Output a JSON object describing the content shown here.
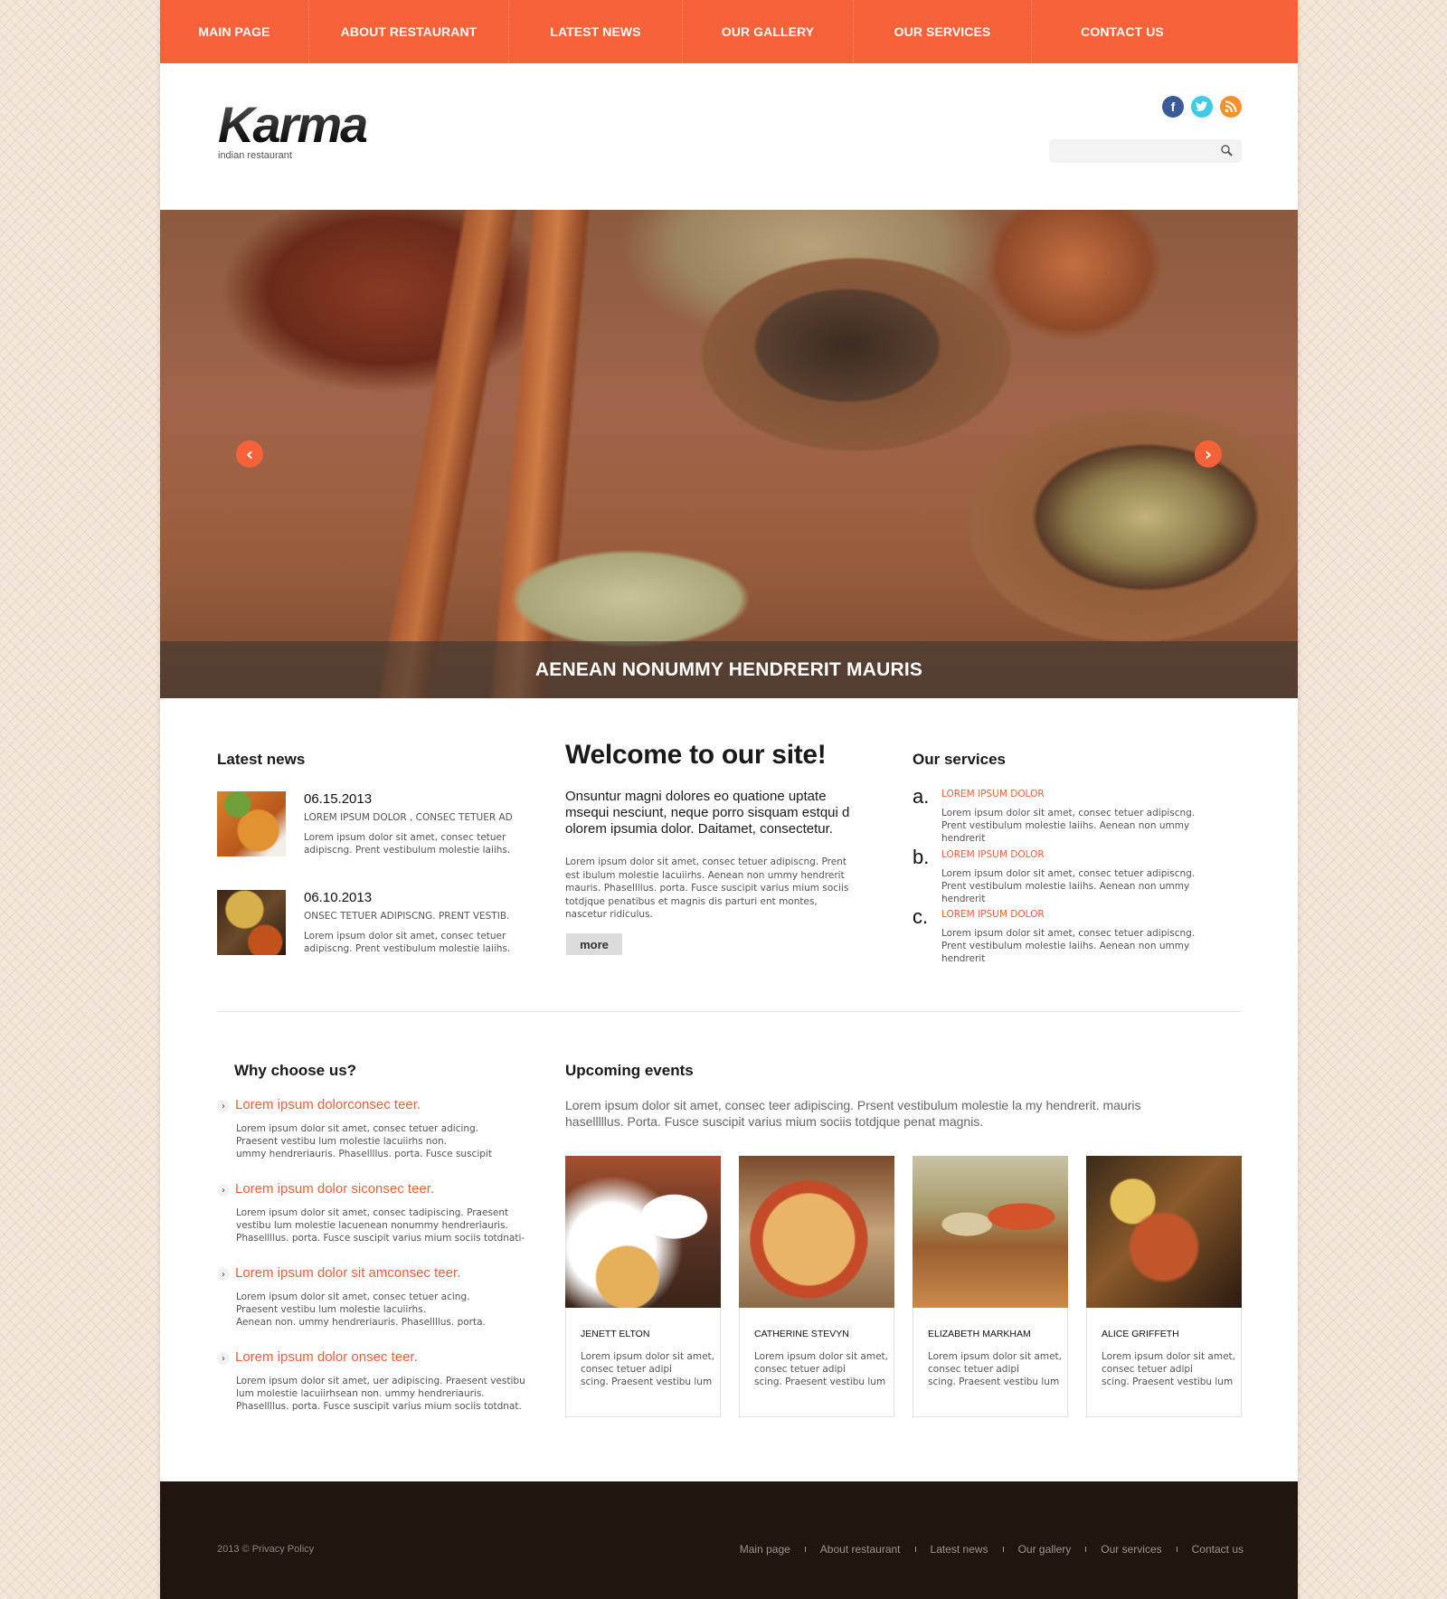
{
  "nav": {
    "items": [
      {
        "label": "MAIN PAGE"
      },
      {
        "label": "ABOUT RESTAURANT"
      },
      {
        "label": "LATEST NEWS"
      },
      {
        "label": "OUR GALLERY"
      },
      {
        "label": "OUR SERVICES"
      },
      {
        "label": "CONTACT US"
      }
    ]
  },
  "header": {
    "logo": "Karma",
    "tagline": "indian restaurant",
    "social": {
      "facebook": "f",
      "twitter": "t",
      "rss": "rss"
    },
    "search": {
      "value": "",
      "placeholder": ""
    }
  },
  "slider": {
    "caption": "AENEAN NONUMMY HENDRERIT MAURIS",
    "prev": "‹",
    "next": "›"
  },
  "latest_news": {
    "heading": "Latest news",
    "items": [
      {
        "date": "06.15.2013",
        "title": "LOREM IPSUM DOLOR , CONSEC TETUER AD",
        "text": "Lorem ipsum dolor sit amet, consec tetuer adipiscng. Prent vestibulum molestie laiihs."
      },
      {
        "date": "06.10.2013",
        "title": "ONSEC TETUER ADIPISCNG. PRENT VESTIB.",
        "text": "Lorem ipsum dolor sit amet, consec tetuer adipiscng. Prent vestibulum molestie laiihs."
      }
    ]
  },
  "welcome": {
    "title": "Welcome to our site!",
    "lead": "Onsuntur magni dolores eo quatione uptate msequi nesciunt, neque porro sisquam estqui d olorem ipsumia dolor. Daitamet, consectetur.",
    "body": "Lorem ipsum dolor sit amet, consec tetuer adipiscng. Prent est ibulum molestie lacuiirhs. Aenean non ummy hendrerit mauris. Phasellllus. porta. Fusce suscipit varius mium sociis totdjque penatibus et magnis dis parturi ent montes, nascetur ridiculus.",
    "more_label": "more"
  },
  "services": {
    "heading": "Our services",
    "items": [
      {
        "letter": "a.",
        "title": "LOREM IPSUM DOLOR",
        "text": "Lorem ipsum dolor sit amet, consec tetuer adipiscng. Prent vestibulum molestie laiihs. Aenean non ummy hendrerit"
      },
      {
        "letter": "b.",
        "title": "LOREM IPSUM DOLOR",
        "text": "Lorem ipsum dolor sit amet, consec tetuer adipiscng. Prent vestibulum molestie laiihs. Aenean non ummy hendrerit"
      },
      {
        "letter": "c.",
        "title": "LOREM IPSUM DOLOR",
        "text": "Lorem ipsum dolor sit amet, consec tetuer adipiscng. Prent vestibulum molestie laiihs. Aenean non ummy hendrerit"
      }
    ]
  },
  "why_choose": {
    "heading": "Why choose us?",
    "bullet": "›",
    "items": [
      {
        "title": "Lorem ipsum dolorconsec teer.",
        "text": "Lorem ipsum dolor sit amet, consec tetuer adicing.\nPraesent vestibu lum molestie lacuiirhs non.\nummy hendreriauris. Phasellllus. porta. Fusce suscipit"
      },
      {
        "title": "Lorem ipsum dolor siconsec teer.",
        "text": "Lorem ipsum dolor sit amet, consec tadipiscing. Praesent\nvestibu lum molestie lacuenean nonummy hendreriauris.\nPhasellllus. porta. Fusce suscipit varius mium sociis totdnati-"
      },
      {
        "title": "Lorem ipsum dolor sit amconsec teer.",
        "text": "Lorem ipsum dolor sit amet, consec tetuer acing.\nPraesent vestibu lum molestie lacuiirhs.\n Aenean non. ummy hendreriauris. Phasellllus. porta."
      },
      {
        "title": "Lorem ipsum dolor onsec teer.",
        "text": "Lorem ipsum dolor sit amet, uer adipiscing. Praesent vestibu\nlum molestie lacuiirhsean non.  ummy hendreriauris.\nPhasellllus. porta. Fusce suscipit varius mium sociis totdnat."
      }
    ]
  },
  "events": {
    "heading": "Upcoming events",
    "intro": "Lorem ipsum dolor sit amet, consec teer adipiscing. Prsent vestibulum molestie la my hendrerit. mauris haselllllus.  Porta. Fusce suscipit varius mium sociis totdjque penat magnis.",
    "cards": [
      {
        "name": "JENETT ELTON",
        "text": "Lorem ipsum dolor sit amet,\nconsec tetuer adipi\nscing. Praesent vestibu lum"
      },
      {
        "name": "CATHERINE STEVYN",
        "text": "Lorem ipsum dolor sit amet,\nconsec tetuer adipi\nscing. Praesent vestibu lum"
      },
      {
        "name": "ELIZABETH MARKHAM",
        "text": "Lorem ipsum dolor sit amet,\nconsec tetuer adipi\nscing. Praesent vestibu lum"
      },
      {
        "name": "ALICE GRIFFETH",
        "text": "Lorem ipsum dolor sit amet,\nconsec tetuer adipi\nscing. Praesent vestibu lum"
      }
    ]
  },
  "footer": {
    "copyright": "2013 © Privacy Policy",
    "links": [
      {
        "label": "Main page"
      },
      {
        "label": "About restaurant"
      },
      {
        "label": "Latest news"
      },
      {
        "label": "Our gallery"
      },
      {
        "label": "Our services"
      },
      {
        "label": "Contact us"
      }
    ]
  },
  "colors": {
    "accent": "#f5623a",
    "link_accent": "#e8613d",
    "footer_bg": "#211510",
    "facebook": "#3b5a9a",
    "twitter": "#3fcbe8",
    "rss": "#f7902a"
  }
}
